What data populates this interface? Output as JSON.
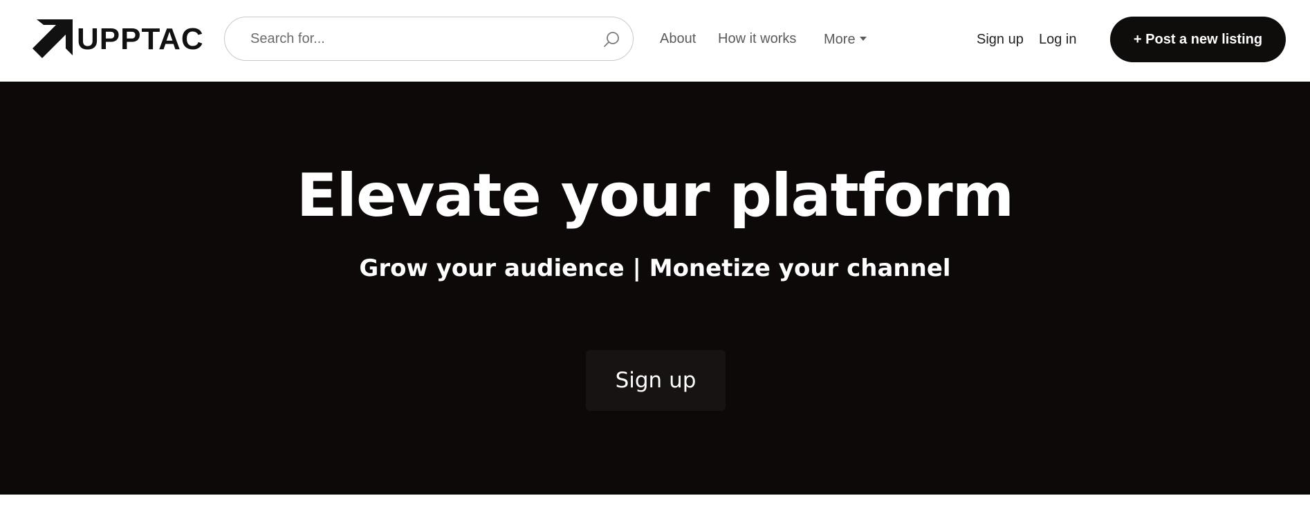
{
  "header": {
    "logo_text": "UPPTAC",
    "search": {
      "placeholder": "Search for...",
      "value": ""
    },
    "nav": {
      "about": "About",
      "how_it_works": "How it works",
      "more": "More",
      "sign_up": "Sign up",
      "log_in": "Log in"
    },
    "post_listing_label": "+ Post a new listing"
  },
  "hero": {
    "title": "Elevate your platform",
    "subtitle": "Grow your audience | Monetize your channel",
    "cta_label": "Sign up"
  },
  "icons": {
    "logo": "arrow-up-right-icon",
    "search": "search-icon",
    "more": "caret-down-icon"
  },
  "colors": {
    "brand_dark": "#0f0d0c",
    "hero_background": "#0c0908",
    "hero_button": "#161312",
    "text_light": "#ffffff",
    "nav_text": "#5a5a5a"
  }
}
